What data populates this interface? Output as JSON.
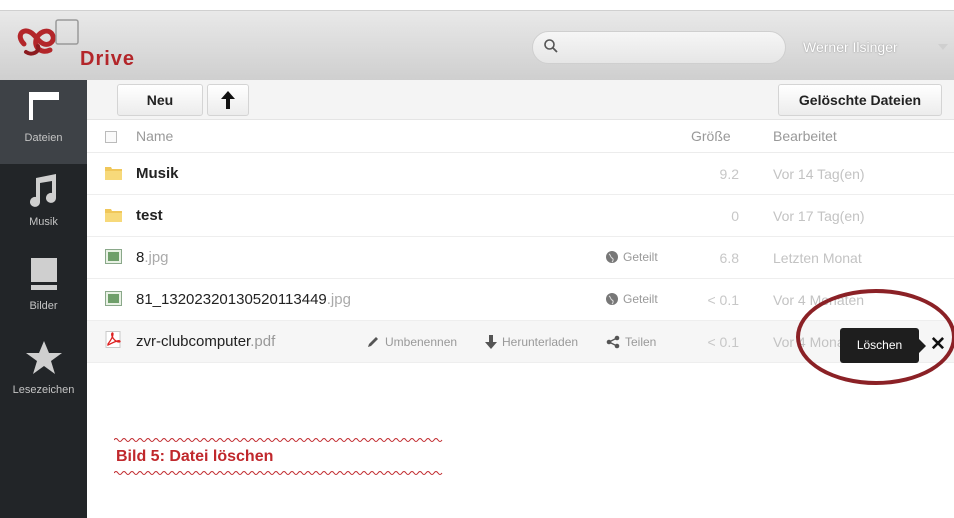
{
  "app": {
    "name": "Drive",
    "user": "Werner Ilsinger"
  },
  "search": {
    "placeholder": ""
  },
  "sidebar": {
    "items": [
      {
        "label": "Dateien",
        "icon": "folder-icon"
      },
      {
        "label": "Musik",
        "icon": "music-note-icon"
      },
      {
        "label": "Bilder",
        "icon": "image-icon"
      },
      {
        "label": "Lesezeichen",
        "icon": "star-icon"
      }
    ]
  },
  "toolbar": {
    "new_label": "Neu",
    "upload_icon": "upload-arrow-icon",
    "deleted_label": "Gelöschte Dateien"
  },
  "table": {
    "headers": {
      "name": "Name",
      "size": "Größe",
      "modified": "Bearbeitet"
    },
    "rows": [
      {
        "name": "Musik",
        "ext": "",
        "type": "folder",
        "size": "9.2",
        "modified": "Vor 14 Tag(en)",
        "shared": ""
      },
      {
        "name": "test",
        "ext": "",
        "type": "folder",
        "size": "0",
        "modified": "Vor 17 Tag(en)",
        "shared": ""
      },
      {
        "name": "8",
        "ext": ".jpg",
        "type": "image",
        "size": "6.8",
        "modified": "Letzten Monat",
        "shared": "Geteilt"
      },
      {
        "name": "81_13202320130520113449",
        "ext": ".jpg",
        "type": "image",
        "size": "< 0.1",
        "modified": "Vor 4 Monaten",
        "shared": "Geteilt"
      },
      {
        "name": "zvr-clubcomputer",
        "ext": ".pdf",
        "type": "pdf",
        "size": "< 0.1",
        "modified": "Vor 4 Monaten",
        "shared": ""
      }
    ],
    "actions": {
      "rename": "Umbenennen",
      "download": "Herunterladen",
      "share": "Teilen"
    }
  },
  "tooltip": {
    "delete": "Löschen",
    "close": "✕"
  },
  "caption": "Bild 5: Datei löschen",
  "colors": {
    "brand": "#b3262a",
    "sidebar": "#222528",
    "sidebar_active": "#3e4247",
    "highlight": "#8b2126",
    "caption": "#c0282c"
  }
}
